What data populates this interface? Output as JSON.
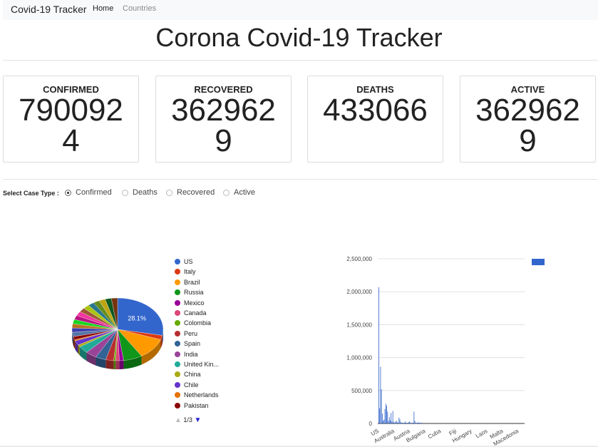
{
  "navbar": {
    "brand": "Covid-19 Tracker",
    "home": "Home",
    "countries": "Countries"
  },
  "page_title": "Corona Covid-19 Tracker",
  "cards": [
    {
      "label": "CONFIRMED",
      "value": "7900924"
    },
    {
      "label": "RECOVERED",
      "value": "3629629"
    },
    {
      "label": "DEATHS",
      "value": "433066"
    },
    {
      "label": "ACTIVE",
      "value": "3629629"
    }
  ],
  "case_type": {
    "label": "Select Case Type :",
    "options": [
      "Confirmed",
      "Deaths",
      "Recovered",
      "Active"
    ],
    "selected": "Confirmed"
  },
  "pie_legend": {
    "items": [
      {
        "name": "US",
        "color": "#3366cc"
      },
      {
        "name": "Italy",
        "color": "#dc3912"
      },
      {
        "name": "Brazil",
        "color": "#ff9900"
      },
      {
        "name": "Russia",
        "color": "#109618"
      },
      {
        "name": "Mexico",
        "color": "#990099"
      },
      {
        "name": "Canada",
        "color": "#dd4477"
      },
      {
        "name": "Colombia",
        "color": "#66aa00"
      },
      {
        "name": "Peru",
        "color": "#b82e2e"
      },
      {
        "name": "Spain",
        "color": "#316395"
      },
      {
        "name": "India",
        "color": "#994499"
      },
      {
        "name": "United Kin...",
        "color": "#22aa99"
      },
      {
        "name": "China",
        "color": "#aaaa11"
      },
      {
        "name": "Chile",
        "color": "#6633cc"
      },
      {
        "name": "Netherlands",
        "color": "#e67300"
      },
      {
        "name": "Pakistan",
        "color": "#8b0707"
      }
    ],
    "page": "1/3"
  },
  "chart_data": [
    {
      "type": "pie",
      "slice_label": "28.1%",
      "categories": [
        "US",
        "Italy",
        "Brazil",
        "Russia",
        "Mexico",
        "Canada",
        "Colombia",
        "Peru",
        "Spain",
        "India",
        "United Kin...",
        "China",
        "Chile",
        "Netherlands",
        "Pakistan"
      ],
      "values": [
        28.1,
        2.2,
        10.9,
        6.7,
        1.5,
        1.3,
        0.7,
        2.8,
        3.7,
        4.0,
        3.7,
        1.1,
        2.3,
        0.6,
        1.7
      ]
    },
    {
      "type": "bar",
      "ylim": [
        0,
        2500000
      ],
      "yticks": [
        "0",
        "500,000",
        "1,000,000",
        "1,500,000",
        "2,000,000",
        "2,500,000"
      ],
      "xtick_labels": [
        "US",
        "Australia",
        "Austria",
        "Bulgaria",
        "Cuba",
        "Fiji",
        "Hungary",
        "Laos",
        "Malta",
        "Macedonia"
      ],
      "bar_color": "#3366cc",
      "values": [
        2070000,
        230000,
        860000,
        520000,
        150000,
        40000,
        60000,
        220000,
        300000,
        270000,
        180000,
        40000,
        100000,
        50000,
        160000,
        30000,
        190000,
        20000,
        10000,
        30000,
        40000,
        20000,
        10000,
        90000,
        60000,
        20000,
        10000,
        10000,
        10000,
        10000,
        30000,
        10000,
        10000,
        10000,
        20000,
        30000,
        10000,
        10000,
        10000,
        10000,
        180000,
        40000,
        10000,
        10000,
        10000,
        20000,
        10000,
        10000,
        10000,
        10000
      ]
    }
  ]
}
